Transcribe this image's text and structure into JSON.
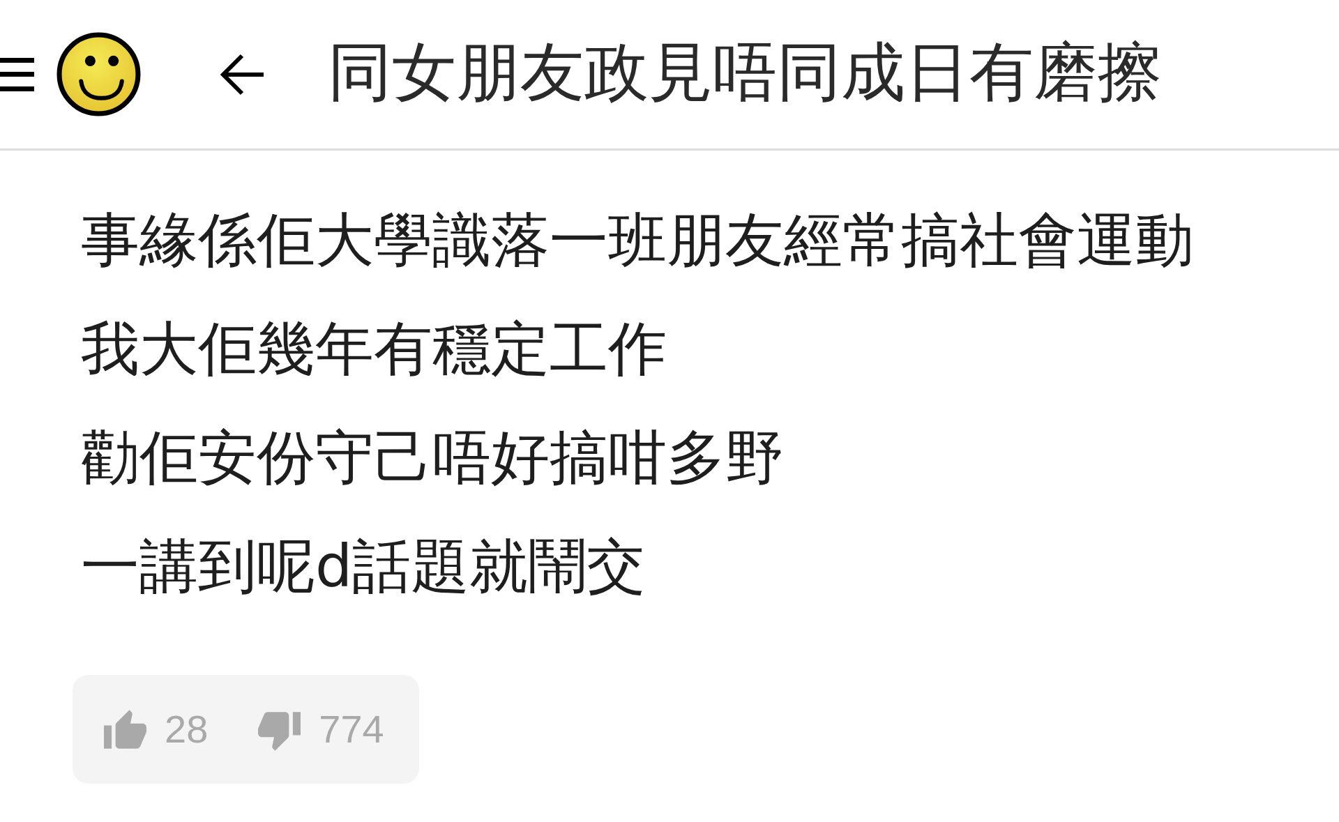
{
  "header": {
    "title": "同女朋友政見唔同成日有磨擦"
  },
  "post": {
    "lines": [
      "事緣係佢大學識落一班朋友經常搞社會運動",
      "我大佢幾年有穩定工作",
      "勸佢安份守己唔好搞咁多野",
      "一講到呢d話題就鬧交"
    ]
  },
  "votes": {
    "likes": "28",
    "dislikes": "774"
  }
}
